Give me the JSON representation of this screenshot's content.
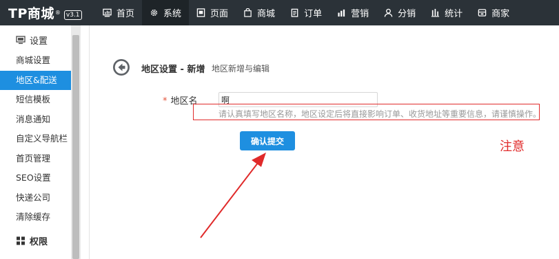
{
  "app": {
    "logo_text": "TP商城",
    "logo_reg": "®",
    "version": "v3.1"
  },
  "nav": [
    {
      "label": "首页",
      "icon": "dashboard-icon"
    },
    {
      "label": "系统",
      "icon": "gear-icon",
      "active": true
    },
    {
      "label": "页面",
      "icon": "page-icon"
    },
    {
      "label": "商城",
      "icon": "shopping-bag-icon"
    },
    {
      "label": "订单",
      "icon": "clipboard-icon"
    },
    {
      "label": "营销",
      "icon": "bar-chart-icon"
    },
    {
      "label": "分销",
      "icon": "user-icon"
    },
    {
      "label": "统计",
      "icon": "stats-icon"
    },
    {
      "label": "商家",
      "icon": "store-icon"
    }
  ],
  "sidebar": {
    "section_settings": "设置",
    "items": [
      {
        "label": "商城设置"
      },
      {
        "label": "地区&配送",
        "active": true
      },
      {
        "label": "短信模板"
      },
      {
        "label": "消息通知"
      },
      {
        "label": "自定义导航栏"
      },
      {
        "label": "首页管理"
      },
      {
        "label": "SEO设置"
      },
      {
        "label": "快递公司"
      },
      {
        "label": "清除缓存"
      }
    ],
    "section_permissions": "权限"
  },
  "main": {
    "title": "地区设置 - 新增",
    "subtitle": "地区新增与编辑",
    "form": {
      "required_mark": "*",
      "name_label": "地区名",
      "name_value": "啊",
      "hint": "请认真填写地区名称，地区设定后将直接影响订单、收货地址等重要信息，请谨慎操作。",
      "submit_label": "确认提交"
    },
    "annotation": "注意"
  },
  "colors": {
    "topbar": "#2b3238",
    "accent": "#1e8fe0",
    "annotation": "#e02a2a"
  }
}
